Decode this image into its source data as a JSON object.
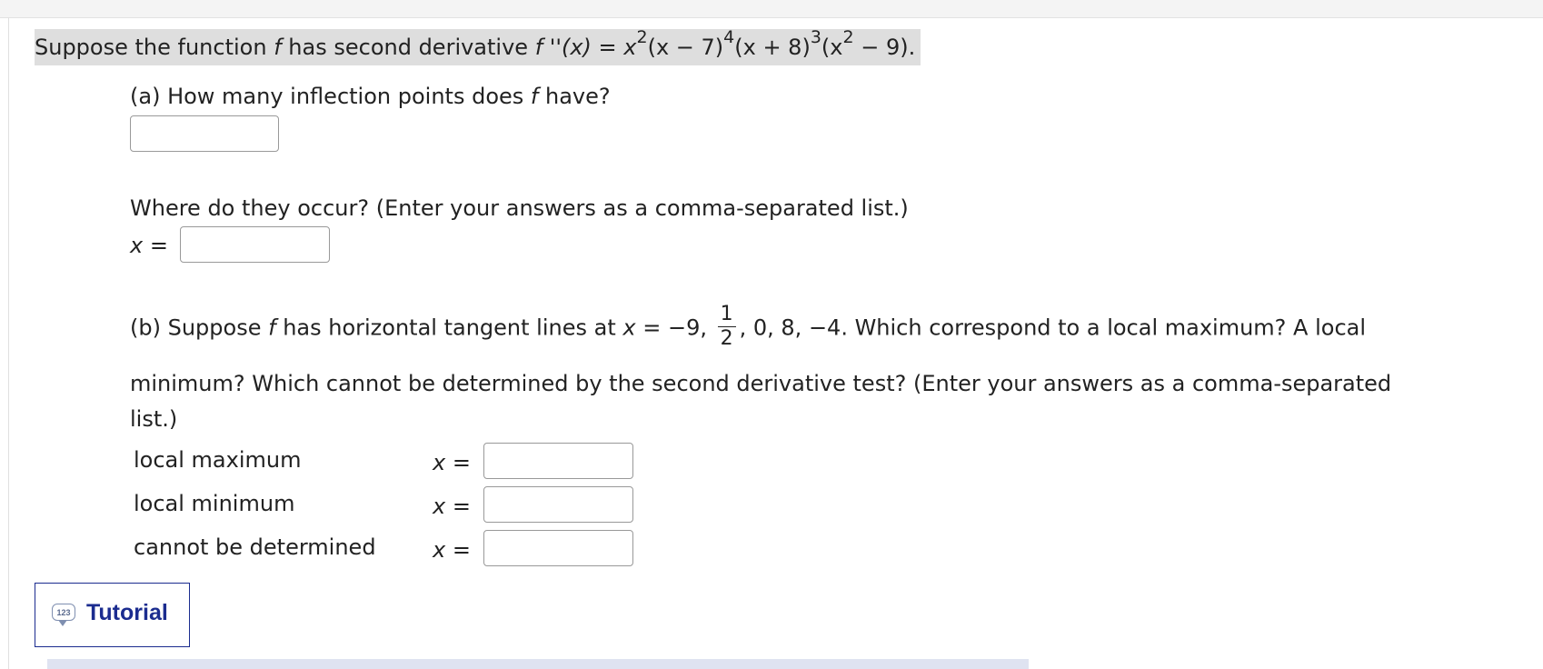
{
  "prompt": {
    "intro": "Suppose the function",
    "f": "f",
    "has_text": "has second derivative",
    "fpp": "f ''(x) = x",
    "exp2a": "2",
    "fac1": "(x − 7)",
    "exp4": "4",
    "fac2": "(x + 8)",
    "exp3": "3",
    "fac3": "(x",
    "exp2b": "2",
    "fac3_end": "− 9)."
  },
  "part_a": {
    "question_pre": "(a) How many inflection points does",
    "f": "f",
    "question_post": "have?",
    "count_value": "",
    "where_text": "Where do they occur? (Enter your answers as a comma-separated list.)",
    "x_label": "x =",
    "where_value": ""
  },
  "part_b": {
    "line1_pre": "(b) Suppose",
    "f": "f",
    "line1_mid": "has horizontal tangent lines at",
    "x_eq": "x =",
    "vals_before": "−9,",
    "frac_num": "1",
    "frac_den": "2",
    "vals_after": ", 0, 8, −4. Which correspond to a local maximum? A local",
    "line2": "minimum? Which cannot be determined by the second derivative test? (Enter your answers as a comma-separated",
    "line3": "list.)",
    "rows": [
      {
        "label": "local maximum",
        "x_label": "x =",
        "value": ""
      },
      {
        "label": "local minimum",
        "x_label": "x =",
        "value": ""
      },
      {
        "label": "cannot be determined",
        "x_label": "x =",
        "value": ""
      }
    ]
  },
  "tutorial": {
    "label": "Tutorial",
    "icon": "calculator-bubble-icon",
    "icon_text": "123"
  },
  "colors": {
    "highlight": "#dedede",
    "tutorial": "#1b2c8f",
    "bottom_bar": "#dfe3f1"
  }
}
